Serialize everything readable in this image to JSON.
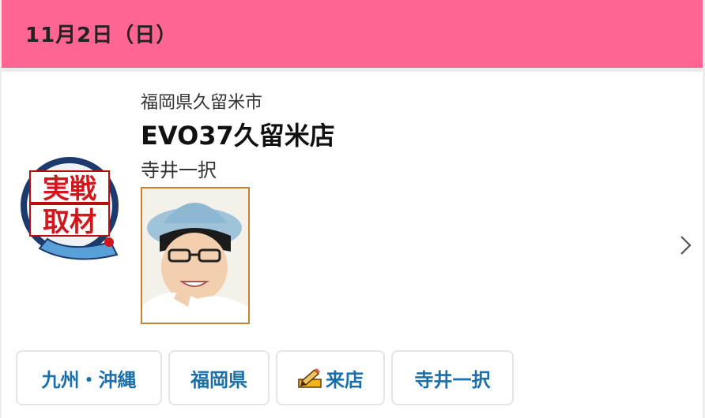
{
  "header": {
    "date": "11月2日（日）"
  },
  "event": {
    "area": "福岡県久留米市",
    "shop_name": "EVO37久留米店",
    "performer": "寺井一択",
    "logo_text_top": "実戦",
    "logo_text_bottom": "取材"
  },
  "tags": [
    {
      "label": "九州・沖縄"
    },
    {
      "label": "福岡県"
    },
    {
      "label": "来店",
      "icon": "pencil-icon"
    },
    {
      "label": "寺井一択"
    }
  ],
  "colors": {
    "header_bg": "#ff6592",
    "tag_text": "#1a6fa8",
    "photo_border": "#c8802c"
  }
}
